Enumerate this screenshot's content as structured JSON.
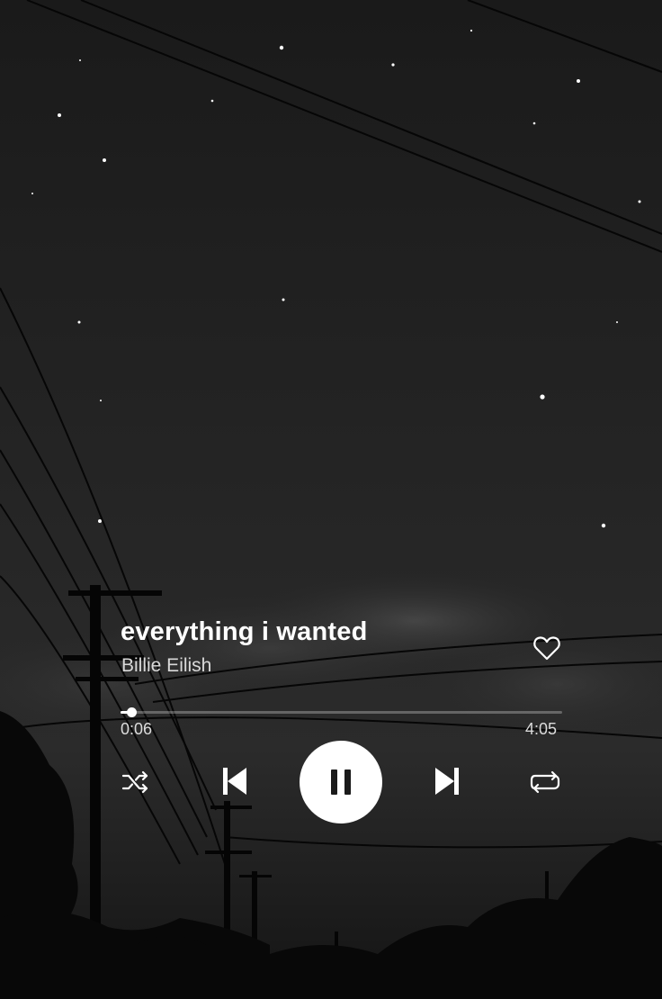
{
  "track": {
    "title": "everything i wanted",
    "artist": "Billie Eilish"
  },
  "progress": {
    "elapsed": "0:06",
    "total": "4:05",
    "fraction": 0.024
  },
  "icons": {
    "like": "heart-outline-icon",
    "shuffle": "shuffle-icon",
    "previous": "skip-previous-icon",
    "play_pause": "pause-icon",
    "next": "skip-next-icon",
    "repeat": "repeat-icon"
  },
  "colors": {
    "foreground": "#ffffff",
    "secondary_text": "#d9d9d9",
    "background_sky": "#1c1c1c"
  }
}
